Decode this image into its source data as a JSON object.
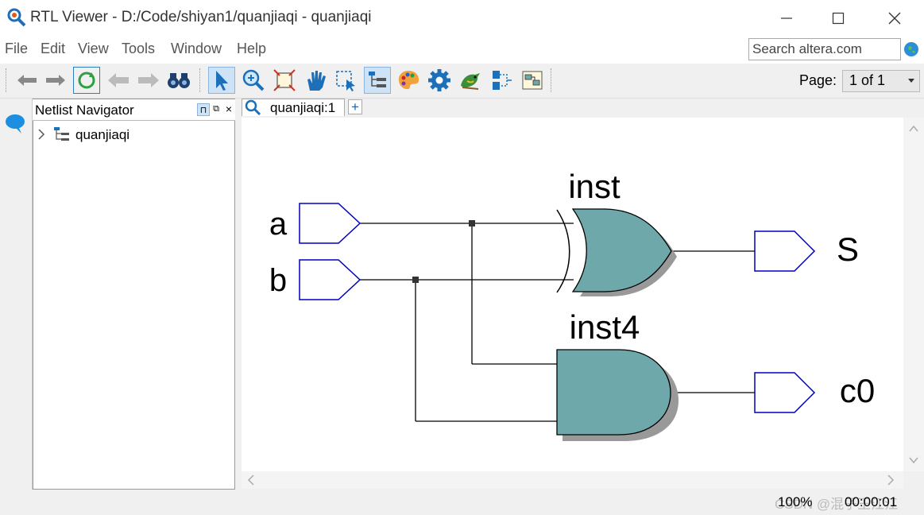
{
  "window": {
    "title": "RTL Viewer - D:/Code/shiyan1/quanjiaqi - quanjiaqi"
  },
  "menu": {
    "items": [
      {
        "label": "File"
      },
      {
        "label": "Edit"
      },
      {
        "label": "View"
      },
      {
        "label": "Tools"
      },
      {
        "label": "Window"
      },
      {
        "label": "Help"
      }
    ],
    "search_value": "Search altera.com"
  },
  "toolbar": {
    "icons": [
      "back-icon",
      "forward-icon",
      "refresh-icon",
      "back-page-icon",
      "forward-page-icon",
      "binoculars-icon",
      "select-arrow-icon",
      "zoom-icon",
      "fit-icon",
      "hand-icon",
      "area-select-icon",
      "hierarchy-icon",
      "palette-icon",
      "gear-icon",
      "bird-icon",
      "netlist-icon",
      "export-icon"
    ],
    "page_label": "Page:",
    "page_value": "1 of 1"
  },
  "navigator": {
    "title": "Netlist Navigator",
    "pin": "⊓",
    "float": "⧉",
    "close": "×",
    "tree": [
      {
        "label": "quanjiaqi"
      }
    ]
  },
  "tabs": [
    {
      "label": "quanjiaqi:1"
    }
  ],
  "tab_add": "+",
  "schematic": {
    "inputs": [
      "a",
      "b"
    ],
    "outputs": [
      "S",
      "c0"
    ],
    "instances": [
      {
        "name": "inst",
        "type": "xor"
      },
      {
        "name": "inst4",
        "type": "and"
      }
    ],
    "gate_color": "#6fa8aa",
    "port_color": "#0000c0"
  },
  "status": {
    "zoom": "100%",
    "time": "00:00:01",
    "watermark": "CSDN @混子王江江"
  }
}
